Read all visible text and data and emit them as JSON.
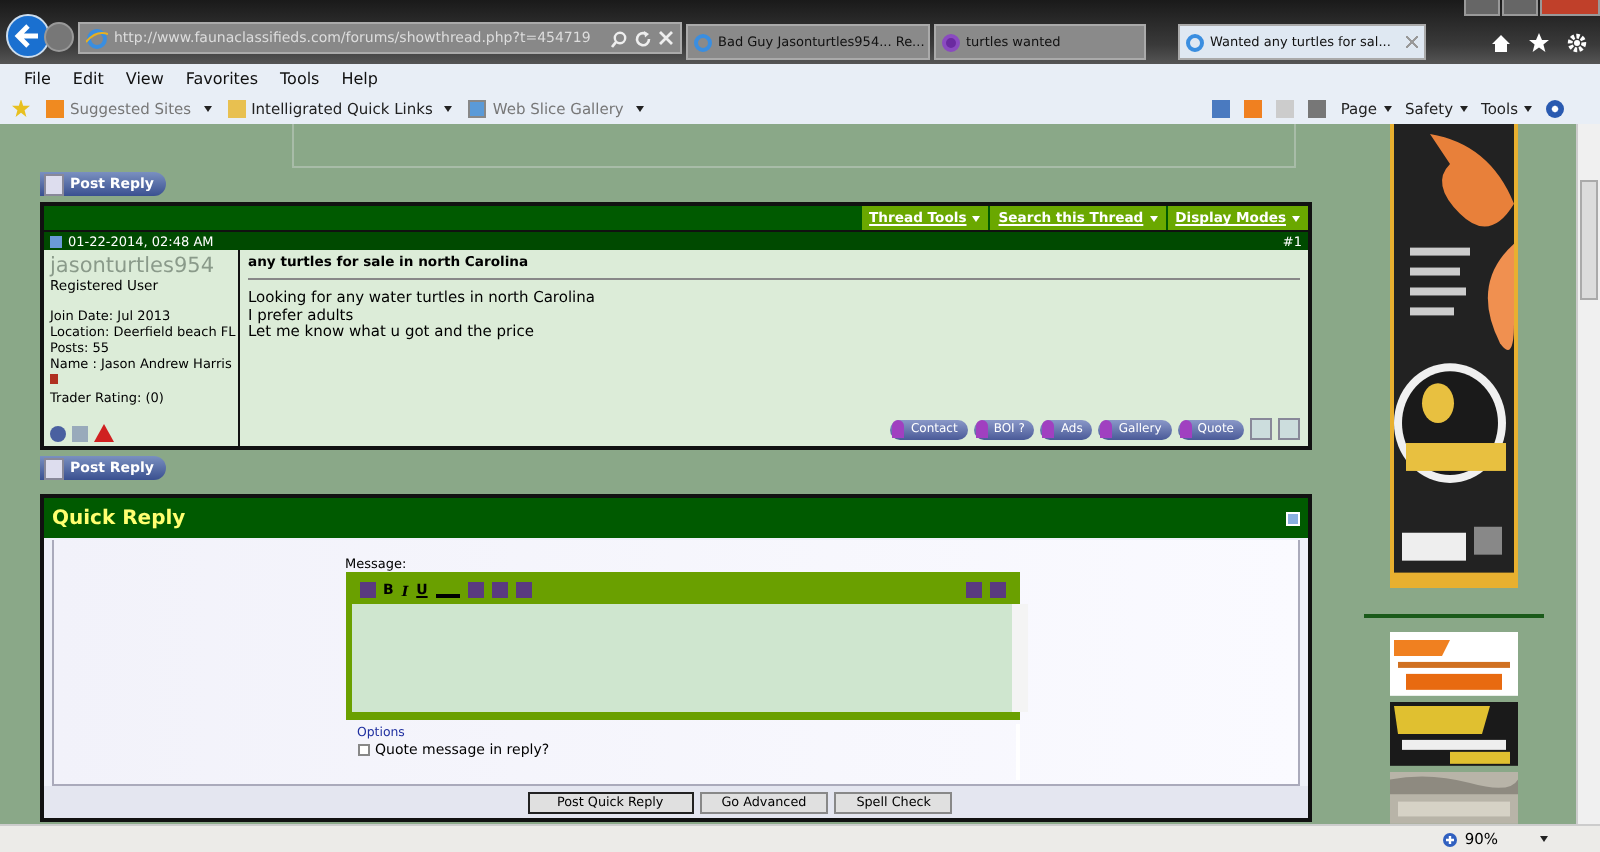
{
  "browser": {
    "address": "http://www.faunaclassifieds.com/forums/showthread.php?t=454719",
    "tabs": [
      {
        "title": "Bad Guy Jasonturtles954... Re...",
        "selected": false
      },
      {
        "title": "turtles wanted",
        "selected": false
      },
      {
        "title": "Wanted any turtles for sal...",
        "selected": true
      }
    ],
    "menu": [
      "File",
      "Edit",
      "View",
      "Favorites",
      "Tools",
      "Help"
    ],
    "favorites": [
      "Suggested Sites",
      "Intelligrated Quick Links",
      "Web Slice Gallery"
    ],
    "command_bar": [
      "Page",
      "Safety",
      "Tools"
    ],
    "zoom": "90%"
  },
  "forum": {
    "post_reply_buttons": [
      "Post Reply",
      "Post Reply"
    ],
    "thread_tools": [
      "Thread Tools",
      "Search this Thread",
      "Display Modes"
    ],
    "post": {
      "date": "01-22-2014, 02:48 AM",
      "number": "#1",
      "username": "jasonturtles954",
      "user_title": "Registered User",
      "details": [
        "Join Date: Jul 2013",
        "Location: Deerfield beach FL",
        "Posts: 55",
        "Name : Jason Andrew Harris"
      ],
      "trader_rating": "Trader Rating: (0)",
      "title": "any turtles for sale in north Carolina",
      "body": [
        "Looking for any water turtles in north Carolina",
        "I prefer adults",
        "Let me know what u got and the price"
      ],
      "buttons": [
        "Contact",
        "BOI ?",
        "Ads",
        "Gallery",
        "Quote"
      ]
    },
    "quick_reply": {
      "title": "Quick Reply",
      "message_label": "Message:",
      "format_buttons": [
        "B",
        "I",
        "U"
      ],
      "options_label": "Options",
      "quote_checkbox": {
        "label": "Quote message in reply?",
        "checked": false
      },
      "buttons": [
        "Post Quick Reply",
        "Go Advanced",
        "Spell Check"
      ]
    }
  }
}
